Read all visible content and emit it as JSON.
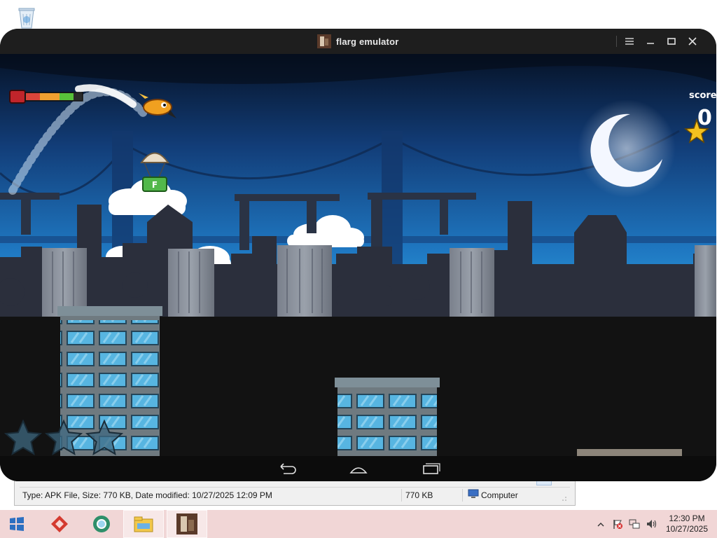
{
  "desktop": {
    "recycle_bin_icon": "recycle-bin-icon"
  },
  "emulator": {
    "title": "flarg emulator",
    "title_icon": "app-icon",
    "controls": [
      "menu-icon",
      "minimize-icon",
      "maximize-icon",
      "close-icon"
    ],
    "nav_buttons": [
      "back-icon",
      "home-icon",
      "recents-icon"
    ]
  },
  "game": {
    "score_label": "score",
    "score_value": "0",
    "health_fraction": 0.85,
    "stars_earned": 0,
    "stars_total": 3,
    "crate_label": "F"
  },
  "explorer": {
    "status": {
      "details": "Type: APK File, Size: 770 KB, Date modified: 10/27/2025 12:09 PM",
      "size": "770 KB",
      "location": "Computer"
    }
  },
  "taskbar": {
    "start_icon": "windows-start-icon",
    "pinned": [
      "red-app-icon",
      "browser-icon",
      "file-explorer-icon",
      "flarg-emulator-icon"
    ],
    "tray_icons": [
      "show-hidden-icons-chevron",
      "action-center-flag-icon",
      "network-icon",
      "volume-icon"
    ],
    "time": "12:30 PM",
    "date": "10/27/2025"
  },
  "colors": {
    "sky_top": "#0a1a3a",
    "sky_mid": "#1b5fa6",
    "sky_horizon": "#2a9ad6",
    "silhouette": "#2b2f3c",
    "building_front": "#7c858f",
    "window_glass": "#58b6e0",
    "taskbar": "#f1d6d6"
  }
}
